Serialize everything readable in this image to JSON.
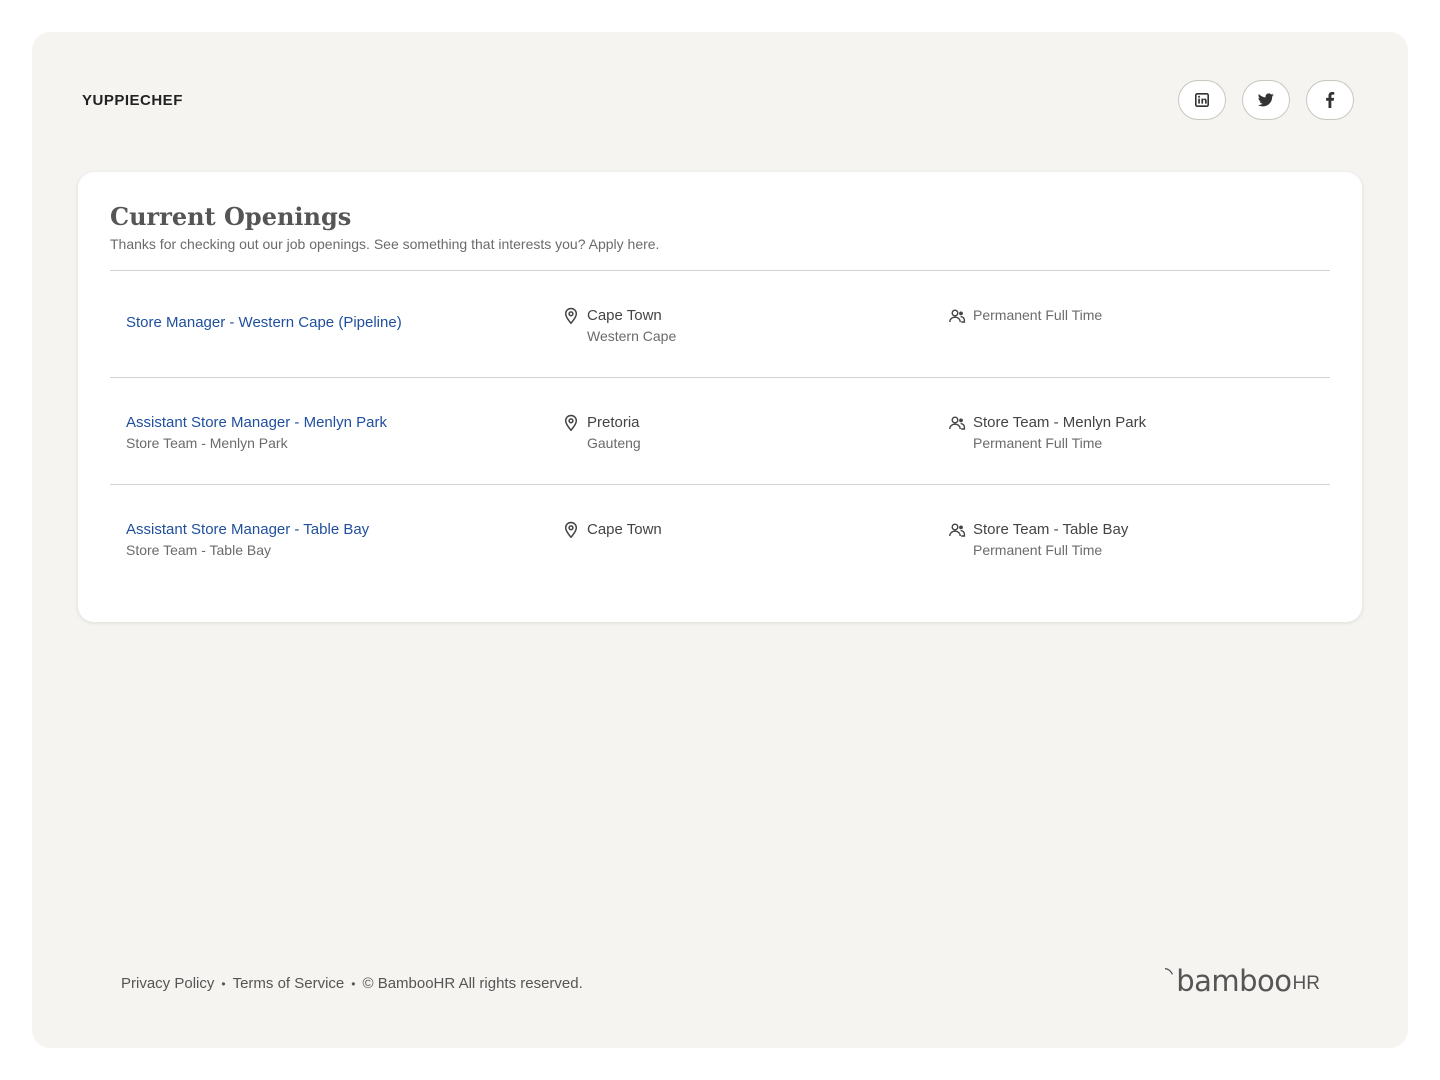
{
  "header": {
    "brand": "YUPPIECHEF",
    "social": [
      {
        "name": "linkedin",
        "icon": "linkedin-icon"
      },
      {
        "name": "twitter",
        "icon": "twitter-icon"
      },
      {
        "name": "facebook",
        "icon": "facebook-icon"
      }
    ]
  },
  "openings": {
    "title": "Current Openings",
    "subtitle": "Thanks for checking out our job openings. See something that interests you? Apply here.",
    "jobs": [
      {
        "title": "Store Manager - Western Cape (Pipeline)",
        "department": "",
        "city": "Cape Town",
        "region": "Western Cape",
        "team": "",
        "employment": "Permanent Full Time"
      },
      {
        "title": "Assistant Store Manager - Menlyn Park",
        "department": "Store Team - Menlyn Park",
        "city": "Pretoria",
        "region": "Gauteng",
        "team": "Store Team - Menlyn Park",
        "employment": "Permanent Full Time"
      },
      {
        "title": "Assistant Store Manager - Table Bay",
        "department": "Store Team - Table Bay",
        "city": "Cape Town",
        "region": "",
        "team": "Store Team - Table Bay",
        "employment": "Permanent Full Time"
      }
    ],
    "icons": {
      "location": "map-pin-icon",
      "employment": "people-icon"
    }
  },
  "footer": {
    "privacy": "Privacy Policy",
    "terms": "Terms of Service",
    "copyright": "© BambooHR All rights reserved.",
    "logo_word": "bamboo",
    "logo_suffix": "HR"
  },
  "colors": {
    "link": "#1f4f9e",
    "background": "#f5f4f1",
    "card": "#ffffff"
  }
}
